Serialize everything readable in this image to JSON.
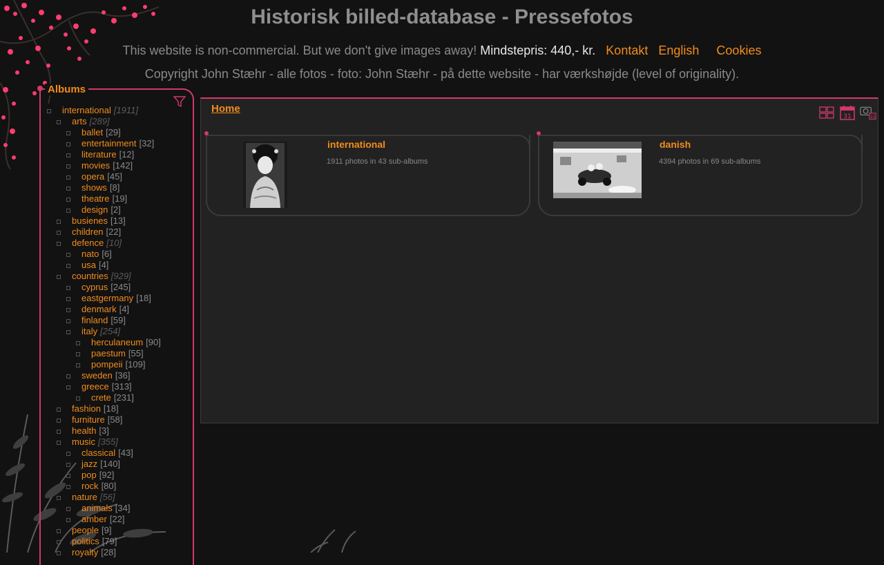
{
  "site": {
    "title": "Historisk billed-database - Pressefotos",
    "notice": "This website is non-commercial. But we don't give images away!",
    "price": "Mindstepris: 440,- kr.",
    "nav": {
      "contact": "Kontakt",
      "english": "English",
      "cookies": "Cookies"
    },
    "copyright": "Copyright John Stæhr - alle fotos - foto: John Stæhr - på dette website - har værkshøjde (level of originality)."
  },
  "sidebar": {
    "title": "Albums",
    "items": [
      {
        "label": "international",
        "count": "[1911]",
        "level": 0,
        "italic": true
      },
      {
        "label": "arts",
        "count": "[289]",
        "level": 1,
        "italic": true
      },
      {
        "label": "ballet",
        "count": "[29]",
        "level": 2
      },
      {
        "label": "entertainment",
        "count": "[32]",
        "level": 2
      },
      {
        "label": "literature",
        "count": "[12]",
        "level": 2
      },
      {
        "label": "movies",
        "count": "[142]",
        "level": 2
      },
      {
        "label": "opera",
        "count": "[45]",
        "level": 2
      },
      {
        "label": "shows",
        "count": "[8]",
        "level": 2
      },
      {
        "label": "theatre",
        "count": "[19]",
        "level": 2
      },
      {
        "label": "design",
        "count": "[2]",
        "level": 2
      },
      {
        "label": "busienes",
        "count": "[13]",
        "level": 1
      },
      {
        "label": "children",
        "count": "[22]",
        "level": 1
      },
      {
        "label": "defence",
        "count": "[10]",
        "level": 1,
        "italic": true
      },
      {
        "label": "nato",
        "count": "[6]",
        "level": 2
      },
      {
        "label": "usa",
        "count": "[4]",
        "level": 2
      },
      {
        "label": "countries",
        "count": "[929]",
        "level": 1,
        "italic": true
      },
      {
        "label": "cyprus",
        "count": "[245]",
        "level": 2
      },
      {
        "label": "eastgermany",
        "count": "[18]",
        "level": 2
      },
      {
        "label": "denmark",
        "count": "[4]",
        "level": 2
      },
      {
        "label": "finland",
        "count": "[59]",
        "level": 2
      },
      {
        "label": "italy",
        "count": "[254]",
        "level": 2,
        "italic": true
      },
      {
        "label": "herculaneum",
        "count": "[90]",
        "level": 3
      },
      {
        "label": "paestum",
        "count": "[55]",
        "level": 3
      },
      {
        "label": "pompeii",
        "count": "[109]",
        "level": 3
      },
      {
        "label": "sweden",
        "count": "[36]",
        "level": 2
      },
      {
        "label": "greece",
        "count": "[313]",
        "level": 2
      },
      {
        "label": "crete",
        "count": "[231]",
        "level": 3
      },
      {
        "label": "fashion",
        "count": "[18]",
        "level": 1
      },
      {
        "label": "furniture",
        "count": "[58]",
        "level": 1
      },
      {
        "label": "health",
        "count": "[3]",
        "level": 1
      },
      {
        "label": "music",
        "count": "[355]",
        "level": 1,
        "italic": true
      },
      {
        "label": "classical",
        "count": "[43]",
        "level": 2
      },
      {
        "label": "jazz",
        "count": "[140]",
        "level": 2
      },
      {
        "label": "pop",
        "count": "[92]",
        "level": 2
      },
      {
        "label": "rock",
        "count": "[80]",
        "level": 2
      },
      {
        "label": "nature",
        "count": "[56]",
        "level": 1,
        "italic": true
      },
      {
        "label": "animals",
        "count": "[34]",
        "level": 2
      },
      {
        "label": "amber",
        "count": "[22]",
        "level": 2
      },
      {
        "label": "people",
        "count": "[9]",
        "level": 1
      },
      {
        "label": "politics",
        "count": "[79]",
        "level": 1
      },
      {
        "label": "royalty",
        "count": "[28]",
        "level": 1
      }
    ]
  },
  "main": {
    "breadcrumb": "Home",
    "view_icons": [
      "thumbnails-icon",
      "calendar-icon",
      "calendar-photo-icon"
    ],
    "albums": [
      {
        "title": "international",
        "meta": "1911 photos in 43 sub-albums"
      },
      {
        "title": "danish",
        "meta": "4394 photos in 69 sub-albums"
      }
    ]
  },
  "colors": {
    "accent": "#f28c1e",
    "border": "#d4386a",
    "background": "#121212",
    "panel": "#222222"
  }
}
